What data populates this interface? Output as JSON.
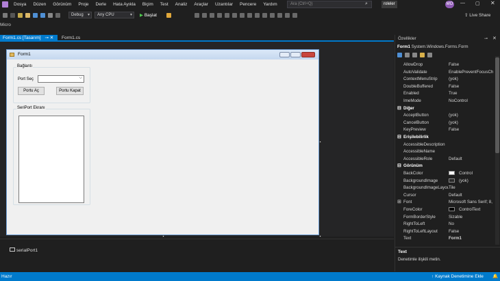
{
  "menu": {
    "items": [
      "Dosya",
      "Düzen",
      "Görünüm",
      "Proje",
      "Derle",
      "Hata Ayıkla",
      "Biçim",
      "Test",
      "Analiz",
      "Araçlar",
      "Uzantılar",
      "Pencere",
      "Yardım"
    ],
    "search_placeholder": "Ara (Ctrl+Q)",
    "solution_name": "roleler",
    "user_initials": "MO"
  },
  "toolbar": {
    "config": "Debug",
    "platform": "Any CPU",
    "start_label": "Başlat",
    "live_share": "Live Share",
    "micro_label": "Micro"
  },
  "tabs": [
    {
      "label": "Form1.cs [Tasarım]",
      "active": true
    },
    {
      "label": "Form1.cs",
      "active": false
    }
  ],
  "form": {
    "title": "Form1",
    "group1_label": "Bağlantı",
    "port_label": "Port Seç",
    "open_button": "Portu Aç",
    "close_button": "Portu Kapat",
    "group2_label": "SeriPort Ekranı"
  },
  "tray": {
    "component": "serialPort1"
  },
  "properties": {
    "panel_title": "Özellikler",
    "object_name": "Form1",
    "object_type": "System.Windows.Forms.Form",
    "rows": [
      {
        "name": "AllowDrop",
        "value": "False"
      },
      {
        "name": "AutoValidate",
        "value": "EnablePreventFocusCh"
      },
      {
        "name": "ContextMenuStrip",
        "value": "(yok)"
      },
      {
        "name": "DoubleBuffered",
        "value": "False"
      },
      {
        "name": "Enabled",
        "value": "True"
      },
      {
        "name": "ImeMode",
        "value": "NoControl"
      },
      {
        "name": "Diğer",
        "value": "",
        "category": true
      },
      {
        "name": "AcceptButton",
        "value": "(yok)"
      },
      {
        "name": "CancelButton",
        "value": "(yok)"
      },
      {
        "name": "KeyPreview",
        "value": "False"
      },
      {
        "name": "Erişilebilirlik",
        "value": "",
        "category": true
      },
      {
        "name": "AccessibleDescription",
        "value": ""
      },
      {
        "name": "AccessibleName",
        "value": ""
      },
      {
        "name": "AccessibleRole",
        "value": "Default"
      },
      {
        "name": "Görünüm",
        "value": "",
        "category": true
      },
      {
        "name": "BackColor",
        "value": "Control",
        "swatch": "#ffffff"
      },
      {
        "name": "BackgroundImage",
        "value": "(yok)",
        "swatch": "#2a2a2a"
      },
      {
        "name": "BackgroundImageLayout",
        "value": "Tile"
      },
      {
        "name": "Cursor",
        "value": "Default"
      },
      {
        "name": "Font",
        "value": "Microsoft Sans Serif; 8,"
      },
      {
        "name": "ForeColor",
        "value": "ControlText",
        "swatch": "#000000"
      },
      {
        "name": "FormBorderStyle",
        "value": "Sizable"
      },
      {
        "name": "RightToLeft",
        "value": "No"
      },
      {
        "name": "RightToLeftLayout",
        "value": "False"
      },
      {
        "name": "Text",
        "value": "Form1"
      }
    ],
    "desc_title": "Text",
    "desc_text": "Denetimle ilişkili metin."
  },
  "status": {
    "left": "Hazır",
    "right": "Kaynak Denetimine Ekle"
  },
  "colors": {
    "accent": "#007acc",
    "background": "#1f1f1f"
  }
}
